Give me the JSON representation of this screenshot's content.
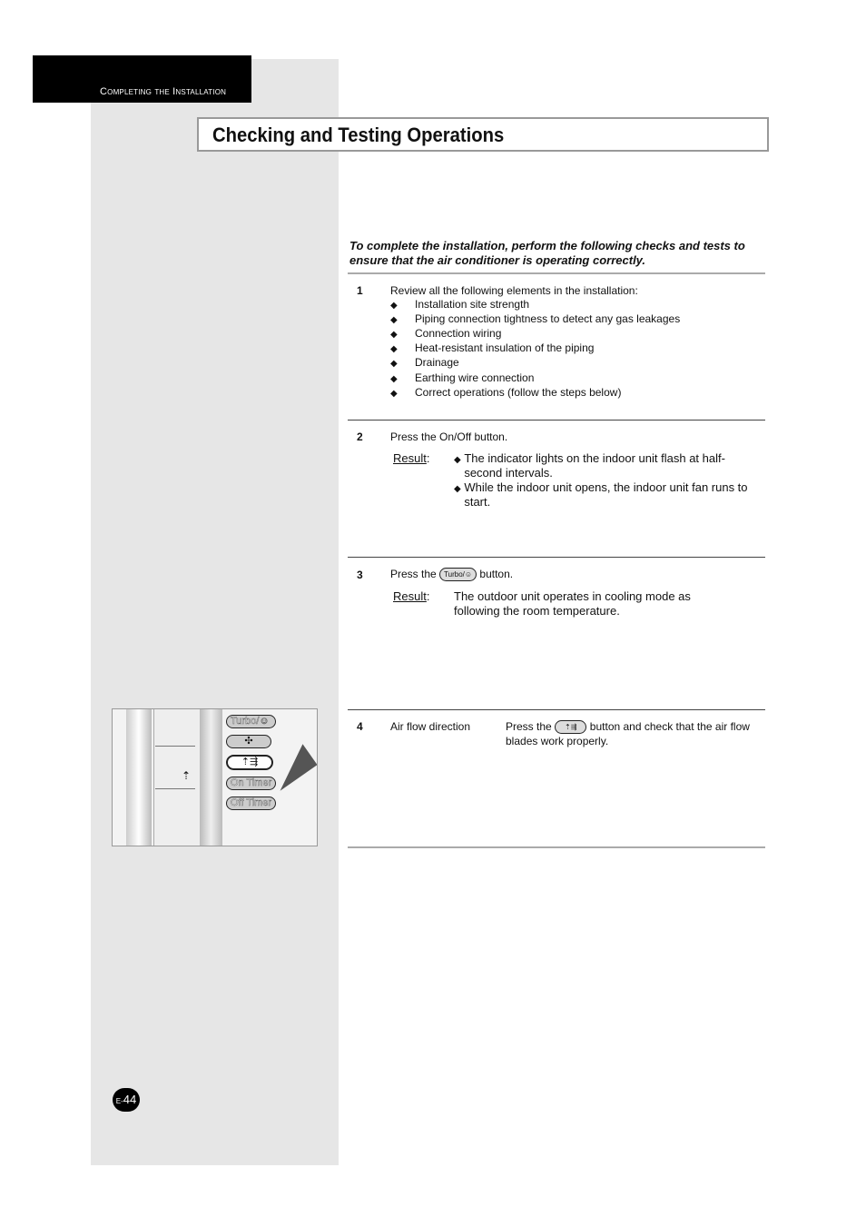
{
  "header": {
    "section": "Completing the Installation"
  },
  "title": "Checking and Testing Operations",
  "intro": "To complete the installation, perform the following checks and tests to ensure that the air conditioner is operating correctly.",
  "steps": [
    {
      "num": "1",
      "text": "Review all the following elements in the installation:",
      "items": [
        "Installation site strength",
        "Piping connection tightness to detect any gas leakages",
        "Connection wiring",
        "Heat-resistant insulation of the piping",
        "Drainage",
        "Earthing wire connection",
        "Correct operations (follow the steps below)"
      ]
    },
    {
      "num": "2",
      "text": "Press the On/Off button.",
      "result_label": "Result",
      "results": [
        "The indicator lights on the indoor unit flash at half-second intervals.",
        "While the indoor unit opens, the indoor unit fan runs to start."
      ]
    },
    {
      "num": "3",
      "text_before": "Press the",
      "button": "Turbo/☺",
      "text_after": "button.",
      "result_label": "Result",
      "result": "The outdoor unit operates in cooling mode as following the room temperature."
    },
    {
      "num": "4",
      "label": "Air flow direction",
      "text_before": "Press the",
      "button": "⇡⇶",
      "text_after": "button and check that the air flow blades work properly."
    }
  ],
  "remote": {
    "buttons": [
      "Turbo/☺",
      "✣",
      "⇡⇶",
      "On Timer",
      "Off Timer"
    ]
  },
  "page_number": {
    "prefix": "E-",
    "number": "44"
  },
  "bullet": "◆"
}
